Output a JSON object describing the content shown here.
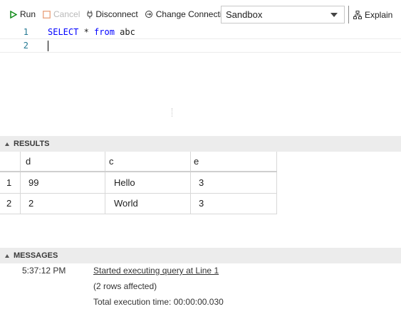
{
  "toolbar": {
    "run_label": "Run",
    "cancel_label": "Cancel",
    "disconnect_label": "Disconnect",
    "change_connection_label": "Change Connection",
    "connection_select": {
      "value": "Sandbox"
    },
    "explain_label": "Explain",
    "icons": {
      "run": "play-icon",
      "cancel": "stop-icon",
      "disconnect": "plug-icon",
      "change_connection": "link-icon",
      "explain": "explain-tree-icon"
    },
    "colors": {
      "run": "#0e8a16",
      "cancel": "#e9a07b"
    }
  },
  "editor": {
    "lines": [
      {
        "number": "1",
        "tokens": {
          "kw1": "SELECT",
          "plain1": " * ",
          "kw2": "from",
          "plain2": " abc"
        }
      },
      {
        "number": "2",
        "text": ""
      }
    ]
  },
  "results": {
    "title": "RESULTS",
    "columns": [
      "d",
      "c",
      "e"
    ],
    "rows": [
      {
        "index": "1",
        "cells": [
          "99",
          "Hello",
          "3"
        ]
      },
      {
        "index": "2",
        "cells": [
          "2",
          "World",
          "3"
        ]
      }
    ]
  },
  "messages": {
    "title": "MESSAGES",
    "time": "5:37:12 PM",
    "lines": [
      "Started executing query at Line 1",
      "(2 rows affected)",
      "Total execution time: 00:00:00.030"
    ]
  }
}
